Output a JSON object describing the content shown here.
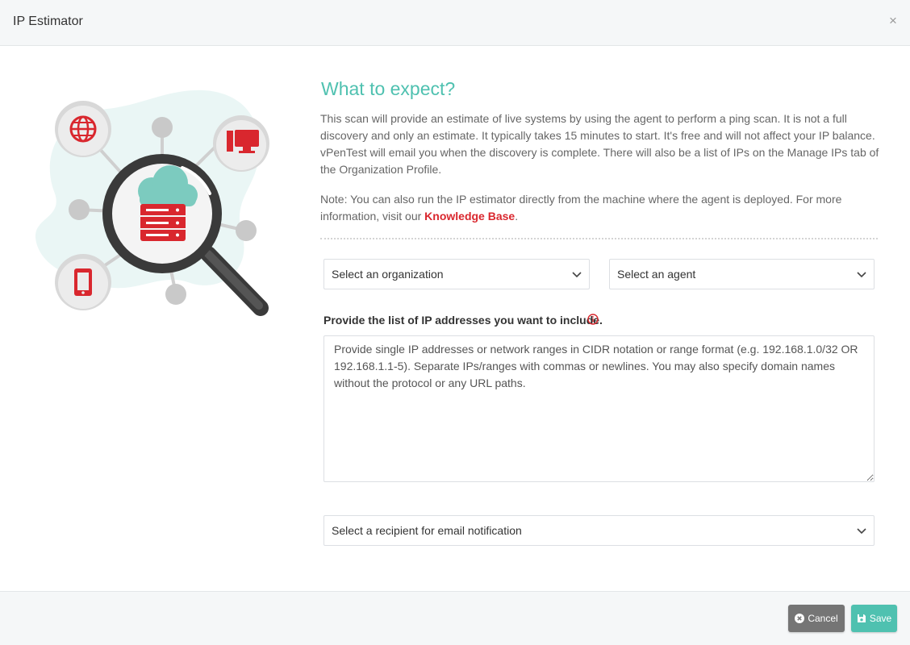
{
  "modal": {
    "title": "IP Estimator",
    "close_symbol": "×"
  },
  "intro": {
    "heading": "What to expect?",
    "paragraph1": "This scan will provide an estimate of live systems by using the agent to perform a ping scan. It is not a full discovery and only an estimate. It typically takes 15 minutes to start. It's free and will not affect your IP balance. vPenTest will email you when the discovery is complete. There will also be a list of IPs on the Manage IPs tab of the Organization Profile.",
    "paragraph2_before": "Note: You can also run the IP estimator directly from the machine where the agent is deployed. For more information, visit our ",
    "link_label": "Knowledge Base",
    "paragraph2_after": "."
  },
  "form": {
    "organization_select": "Select an organization",
    "agent_select": "Select an agent",
    "ip_label": "Provide the list of IP addresses you want to include.",
    "ip_placeholder": "Provide single IP addresses or network ranges in CIDR notation or range format (e.g. 192.168.1.0/32 OR 192.168.1.1-5). Separate IPs/ranges with commas or newlines. You may also specify domain names without the protocol or any URL paths.",
    "ip_value": "",
    "recipient_select": "Select a recipient for email notification"
  },
  "footer": {
    "cancel_label": "Cancel",
    "save_label": "Save"
  },
  "colors": {
    "accent": "#4fc1b0",
    "danger": "#d9272e",
    "cancel": "#757575"
  },
  "icons": {
    "close": "close-icon",
    "chevron": "chevron-down-icon",
    "info": "info-icon",
    "cancel": "times-circle-icon",
    "save": "floppy-disk-icon"
  }
}
